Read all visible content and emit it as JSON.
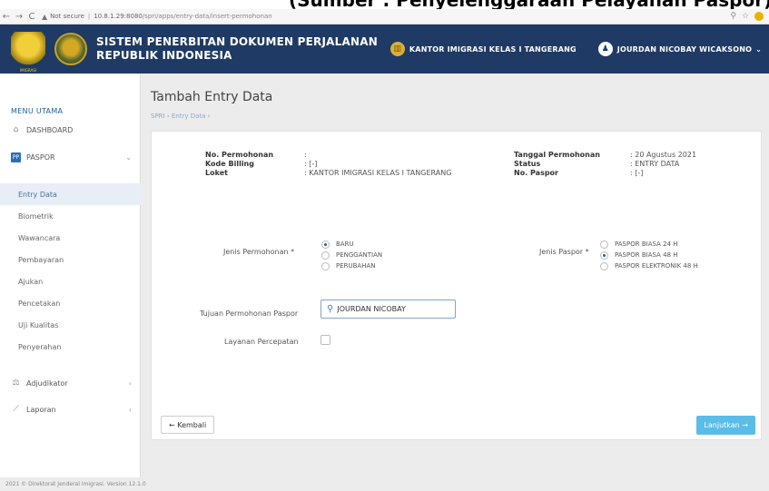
{
  "caption": "(Sumber : Penyelenggaraan Pelayanan Paspor)",
  "browser": {
    "security": "Not secure",
    "host": "10.8.1.29:8080",
    "path": "/spri/apps/entry-data/insert-permohonan"
  },
  "header": {
    "title_line1": "SISTEM PENERBITAN DOKUMEN PERJALANAN",
    "title_line2": "REPUBLIK INDONESIA",
    "office": "KANTOR IMIGRASI KELAS I TANGERANG",
    "user": "JOURDAN NICOBAY WICAKSONO",
    "logo_text": "IMIGRASI"
  },
  "sidebar": {
    "menu_title": "MENU UTAMA",
    "dashboard": "DASHBOARD",
    "paspor": "PASPOR",
    "paspor_icon_text": "PP",
    "sub_items": [
      "Entry Data",
      "Biometrik",
      "Wawancara",
      "Pembayaran",
      "Ajukan",
      "Pencetakan",
      "Uji Kualitas",
      "Penyerahan"
    ],
    "adjudikator": "Adjudikator",
    "laporan": "Laporan"
  },
  "page": {
    "title": "Tambah Entry Data",
    "breadcrumb_root": "SPRI",
    "breadcrumb_current": "Entry Data"
  },
  "info": {
    "no_permohonan_label": "No. Permohonan",
    "no_permohonan_value": ":",
    "kode_billing_label": "Kode Billing",
    "kode_billing_value": ": [-]",
    "loket_label": "Loket",
    "loket_value": ": KANTOR IMIGRASI KELAS I TANGERANG",
    "tanggal_label": "Tanggal Permohonan",
    "tanggal_value": ": 20 Agustus 2021",
    "status_label": "Status",
    "status_value": ": ENTRY DATA",
    "no_paspor_label": "No. Paspor",
    "no_paspor_value": ": [-]"
  },
  "form": {
    "jenis_permohonan_label": "Jenis Permohonan *",
    "jenis_permohonan_options": [
      "BARU",
      "PENGGANTIAN",
      "PERUBAHAN"
    ],
    "jenis_paspor_label": "Jenis Paspor *",
    "jenis_paspor_options": [
      "PASPOR BIASA 24 H",
      "PASPOR BIASA 48 H",
      "PASPOR ELEKTRONIK 48 H"
    ],
    "tujuan_label": "Tujuan Permohonan Paspor",
    "tujuan_value": "JOURDAN NICOBAY",
    "layanan_label": "Layanan Percepatan",
    "back_label": "← Kembali",
    "next_label": "Lanjutkan →"
  },
  "footer": "2021 © Direktorat Jenderal Imigrasi. Version 12.1.0"
}
